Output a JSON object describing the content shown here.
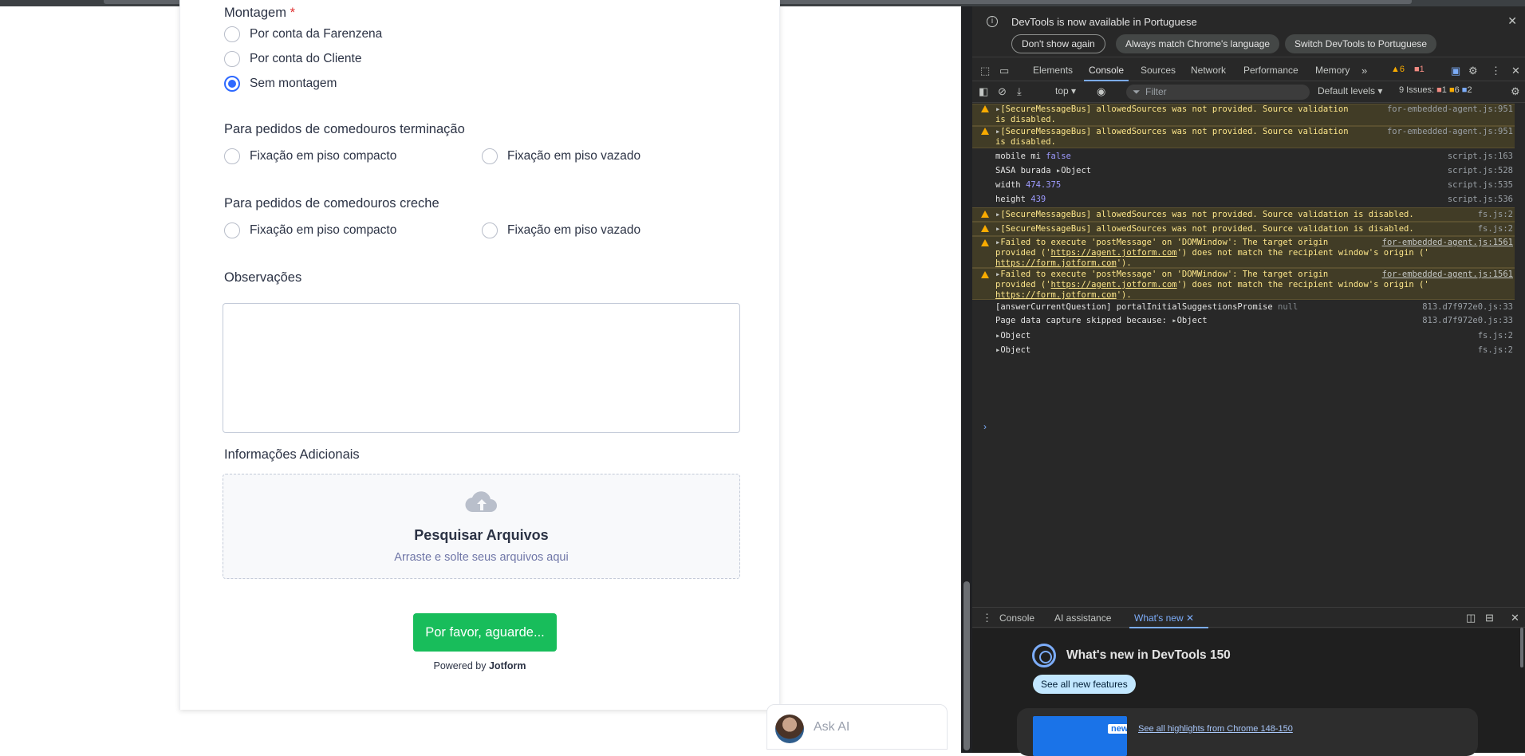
{
  "form": {
    "montagem_label": "Montagem",
    "required_mark": "*",
    "montagem_options": [
      "Por conta da Farenzena",
      "Por conta do Cliente",
      "Sem montagem"
    ],
    "terminacao_label": "Para pedidos de comedouros terminação",
    "terminacao_options": [
      "Fixação em piso compacto",
      "Fixação em piso vazado"
    ],
    "creche_label": "Para pedidos de comedouros creche",
    "creche_options": [
      "Fixação em piso compacto",
      "Fixação em piso vazado"
    ],
    "observacoes_label": "Observações",
    "observacoes_value": "",
    "info_label": "Informações Adicionais",
    "upload_title": "Pesquisar Arquivos",
    "upload_sub": "Arraste e solte seus arquivos aqui",
    "upload_icon": "cloud-upload-icon",
    "submit_label": "Por favor, aguarde...",
    "powered_prefix": "Powered by",
    "powered_brand": "Jotform",
    "ask_ai": "Ask AI"
  },
  "devtools": {
    "info_message": "DevTools is now available in Portuguese",
    "btn_dont_show": "Don't show again",
    "btn_match": "Always match Chrome's language",
    "btn_switch": "Switch DevTools to Portuguese",
    "tabs": [
      "Elements",
      "Console",
      "Sources",
      "Network",
      "Performance",
      "Memory"
    ],
    "active_tab": "Console",
    "warn_count": "6",
    "error_count": "1",
    "context": "top",
    "filter_placeholder": "Filter",
    "levels": "Default levels",
    "issues_label": "9 Issues:",
    "issues_err": "1",
    "issues_warn": "6",
    "issues_info": "2",
    "logs": [
      {
        "type": "warn",
        "text": "[SecureMessageBus] allowedSources was not provided. Source validation",
        "text2": "is disabled.",
        "src": "for-embedded-agent.js:951"
      },
      {
        "type": "warn",
        "text": "[SecureMessageBus] allowedSources was not provided. Source validation",
        "text2": "is disabled.",
        "src": "for-embedded-agent.js:951"
      },
      {
        "type": "log",
        "text": "mobile mi",
        "val": "false",
        "src": "script.js:163"
      },
      {
        "type": "log",
        "text": "SASA burada",
        "val": "Object",
        "src": "script.js:528"
      },
      {
        "type": "log",
        "text": "width",
        "val": "474.375",
        "src": "script.js:535"
      },
      {
        "type": "log",
        "text": "height",
        "val": "439",
        "src": "script.js:536"
      },
      {
        "type": "warn",
        "text": "[SecureMessageBus] allowedSources was not provided. Source validation is disabled.",
        "src": "fs.js:2"
      },
      {
        "type": "warn",
        "text": "[SecureMessageBus] allowedSources was not provided. Source validation is disabled.",
        "src": "fs.js:2"
      },
      {
        "type": "warn",
        "text": "Failed to execute 'postMessage' on 'DOMWindow': The target origin",
        "text2a": "provided ('",
        "url1": "https://agent.jotform.com",
        "text2b": "') does not match the recipient window's origin ('",
        "url2": "https://form.jotform.com",
        "text3": "').",
        "src": "for-embedded-agent.js:1561"
      },
      {
        "type": "warn",
        "text": "Failed to execute 'postMessage' on 'DOMWindow': The target origin",
        "text2a": "provided ('",
        "url1": "https://agent.jotform.com",
        "text2b": "') does not match the recipient window's origin ('",
        "url2": "https://form.jotform.com",
        "text3": "').",
        "src": "for-embedded-agent.js:1561"
      },
      {
        "type": "log",
        "text": "[answerCurrentQuestion] portalInitialSuggestionsPromise",
        "val": "null",
        "src": "813.d7f972e0.js:33"
      },
      {
        "type": "log",
        "text": "Page data capture skipped because:",
        "val": "Object",
        "src": "813.d7f972e0.js:33"
      },
      {
        "type": "log",
        "text": "",
        "val": "Object",
        "src": "fs.js:2"
      },
      {
        "type": "log",
        "text": "",
        "val": "Object",
        "src": "fs.js:2"
      }
    ],
    "prompt": "›",
    "drawer_tabs": [
      "Console",
      "AI assistance",
      "What's new"
    ],
    "drawer_active": "What's new",
    "whatsnew_title": "What's new in DevTools 150",
    "whatsnew_btn": "See all new features",
    "whatsnew_badge": "new",
    "whatsnew_link": "See all highlights from Chrome 148-150"
  }
}
